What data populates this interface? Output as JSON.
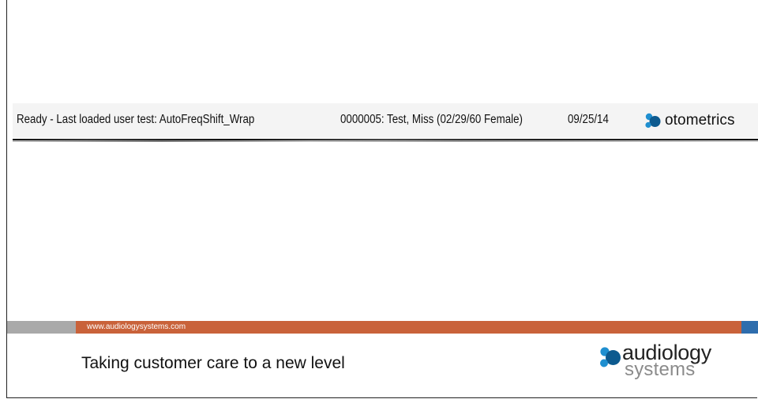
{
  "status_bar": {
    "ready_text": "Ready - Last loaded user test: AutoFreqShift_Wrap",
    "patient_text": "0000005: Test, Miss (02/29/60 Female)",
    "date_text": "09/25/14",
    "brand_name": "otometrics",
    "brand_icon": "otometrics-logo-icon"
  },
  "footer": {
    "url": "www.audiologysystems.com",
    "tagline": "Taking customer care to a new level",
    "logo_word1": "audiology",
    "logo_word2": "systems",
    "logo_icon": "audiology-systems-logo-icon"
  },
  "colors": {
    "band_grey": "#a9a9a9",
    "band_orange": "#c9623a",
    "band_blue": "#2e6dad",
    "logo_blue": "#1f8fd0",
    "logo_dark_blue": "#0d5a8f"
  }
}
